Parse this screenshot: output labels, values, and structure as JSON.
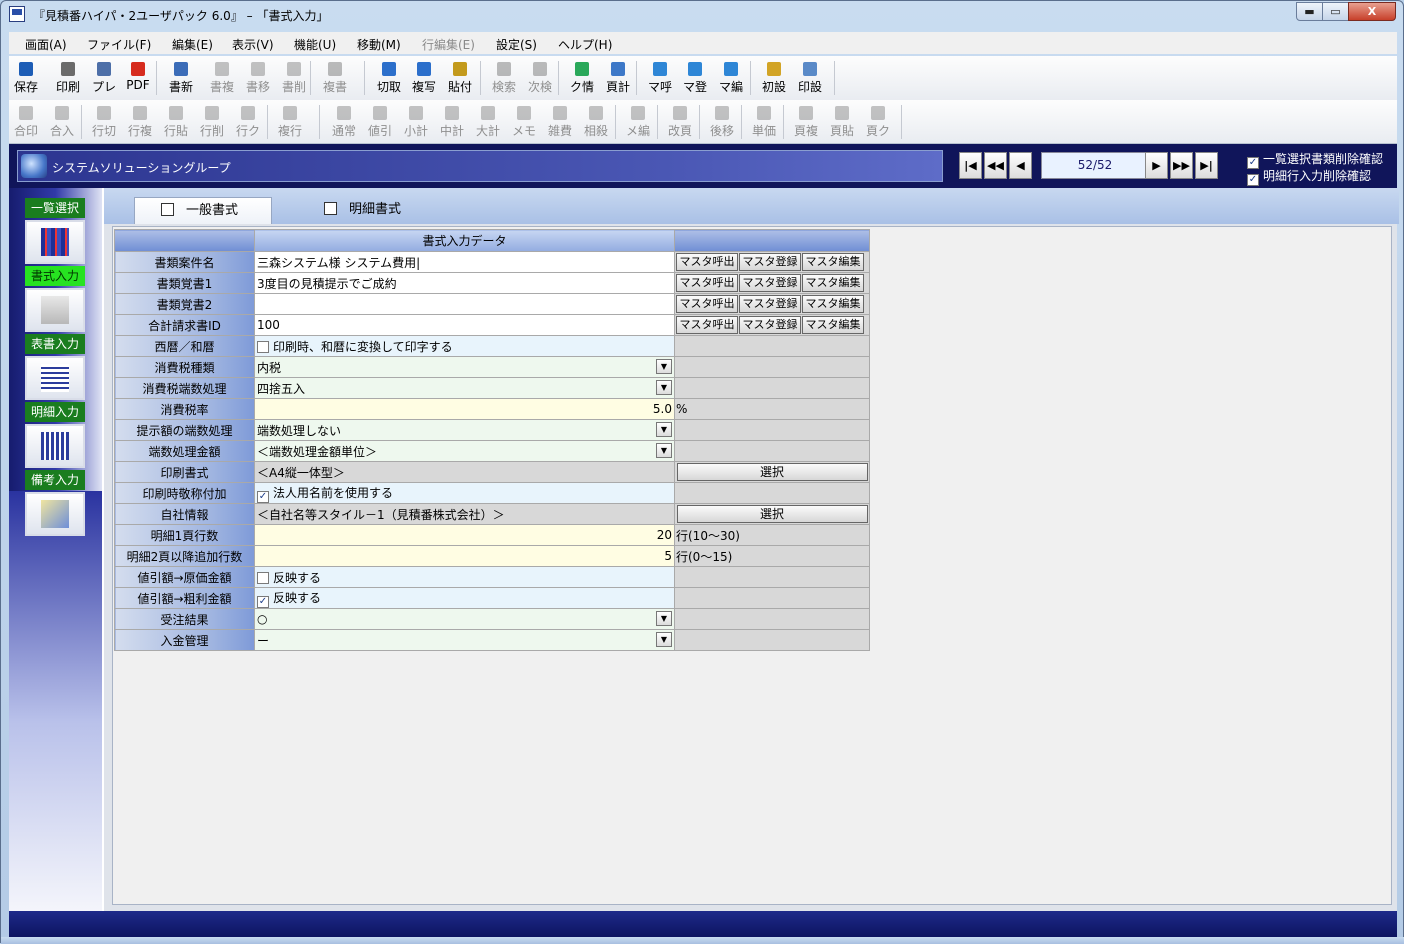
{
  "window": {
    "title": "『見積番ハイパ・2ユーザパック 6.0』 – 「書式入力」",
    "min_label": "▬",
    "max_label": "▭",
    "close_label": "X"
  },
  "menu": [
    {
      "label": "画面(A)",
      "enabled": true
    },
    {
      "label": "ファイル(F)",
      "enabled": true
    },
    {
      "label": "編集(E)",
      "enabled": true
    },
    {
      "label": "表示(V)",
      "enabled": true
    },
    {
      "label": "機能(U)",
      "enabled": true
    },
    {
      "label": "移動(M)",
      "enabled": true
    },
    {
      "label": "行編集(E)",
      "enabled": false
    },
    {
      "label": "設定(S)",
      "enabled": true
    },
    {
      "label": "ヘルプ(H)",
      "enabled": true
    }
  ],
  "toolbar1": [
    {
      "label": "保存",
      "icon": "save-icon",
      "enabled": true
    },
    {
      "label": "印刷",
      "icon": "print-icon",
      "enabled": true
    },
    {
      "label": "プレ",
      "icon": "preview-icon",
      "enabled": true
    },
    {
      "label": "PDF",
      "icon": "pdf-icon",
      "enabled": true
    },
    {
      "label": "書新",
      "icon": "new-doc-icon",
      "enabled": true
    },
    {
      "label": "書複",
      "icon": "copy-doc-icon",
      "enabled": false
    },
    {
      "label": "書移",
      "icon": "move-doc-icon",
      "enabled": false
    },
    {
      "label": "書削",
      "icon": "delete-doc-icon",
      "enabled": false
    },
    {
      "label": "複書",
      "icon": "multi-doc-icon",
      "enabled": false
    },
    {
      "label": "切取",
      "icon": "cut-icon",
      "enabled": true
    },
    {
      "label": "複写",
      "icon": "copy-icon",
      "enabled": true
    },
    {
      "label": "貼付",
      "icon": "paste-icon",
      "enabled": true
    },
    {
      "label": "検索",
      "icon": "search-icon",
      "enabled": false
    },
    {
      "label": "次検",
      "icon": "search-next-icon",
      "enabled": false
    },
    {
      "label": "ク情",
      "icon": "client-info-icon",
      "enabled": true
    },
    {
      "label": "頁計",
      "icon": "page-total-icon",
      "enabled": true
    },
    {
      "label": "マ呼",
      "icon": "master-call-icon",
      "enabled": true
    },
    {
      "label": "マ登",
      "icon": "master-register-icon",
      "enabled": true
    },
    {
      "label": "マ編",
      "icon": "master-edit-icon",
      "enabled": true
    },
    {
      "label": "初設",
      "icon": "initial-settings-icon",
      "enabled": true
    },
    {
      "label": "印設",
      "icon": "print-settings-icon",
      "enabled": true
    }
  ],
  "toolbar2": [
    {
      "label": "合印",
      "icon": "merge-print-icon"
    },
    {
      "label": "合入",
      "icon": "merge-input-icon"
    },
    {
      "label": "行切",
      "icon": "row-cut-icon"
    },
    {
      "label": "行複",
      "icon": "row-copy-icon"
    },
    {
      "label": "行貼",
      "icon": "row-paste-icon"
    },
    {
      "label": "行削",
      "icon": "row-delete-icon"
    },
    {
      "label": "行ク",
      "icon": "row-clear-icon"
    },
    {
      "label": "複行",
      "icon": "multi-row-icon"
    },
    {
      "label": "通常",
      "icon": "normal-row-icon"
    },
    {
      "label": "値引",
      "icon": "discount-icon"
    },
    {
      "label": "小計",
      "icon": "subtotal-icon"
    },
    {
      "label": "中計",
      "icon": "midtotal-icon"
    },
    {
      "label": "大計",
      "icon": "grandtotal-icon"
    },
    {
      "label": "メモ",
      "icon": "memo-icon"
    },
    {
      "label": "雑費",
      "icon": "misc-cost-icon"
    },
    {
      "label": "相殺",
      "icon": "offset-icon"
    },
    {
      "label": "メ編",
      "icon": "memo-edit-icon"
    },
    {
      "label": "改頁",
      "icon": "page-break-icon"
    },
    {
      "label": "後移",
      "icon": "move-back-icon"
    },
    {
      "label": "単価",
      "icon": "unit-price-icon"
    },
    {
      "label": "頁複",
      "icon": "page-copy-icon"
    },
    {
      "label": "頁貼",
      "icon": "page-paste-icon"
    },
    {
      "label": "頁ク",
      "icon": "page-clear-icon"
    }
  ],
  "header": {
    "group_name": "システムソリューショングループ",
    "page_indicator": "52/52",
    "nav_first": "|◀",
    "nav_prev_fast": "◀◀",
    "nav_prev": "◀",
    "nav_next": "▶",
    "nav_next_fast": "▶▶",
    "nav_last": "▶|",
    "check1_label": "一覧選択書類削除確認",
    "check2_label": "明細行入力削除確認"
  },
  "sidebar": [
    {
      "label": "一覧選択",
      "active": false,
      "icon": "list-grid-icon"
    },
    {
      "label": "書式入力",
      "active": true,
      "icon": "format-ruler-icon"
    },
    {
      "label": "表書入力",
      "active": false,
      "icon": "cover-doc-icon"
    },
    {
      "label": "明細入力",
      "active": false,
      "icon": "detail-table-icon"
    },
    {
      "label": "備考入力",
      "active": false,
      "icon": "notes-edit-icon"
    }
  ],
  "tabs": [
    {
      "label": "一般書式",
      "active": true
    },
    {
      "label": "明細書式",
      "active": false
    }
  ],
  "form": {
    "column_header": "書式入力データ",
    "master_call": "マスタ呼出",
    "master_register": "マスタ登録",
    "master_edit": "マスタ編集",
    "select": "選択",
    "rows": [
      {
        "label": "書類案件名",
        "type": "text",
        "value": "三森システム様 システム費用|",
        "actions": "master"
      },
      {
        "label": "書類覚書1",
        "type": "text",
        "value": "3度目の見積提示でご成約",
        "actions": "master"
      },
      {
        "label": "書類覚書2",
        "type": "text",
        "value": "",
        "actions": "master"
      },
      {
        "label": "合計請求書ID",
        "type": "text",
        "value": "100",
        "actions": "master"
      },
      {
        "label": "西暦／和暦",
        "type": "check",
        "checked": false,
        "value": "印刷時、和暦に変換して印字する"
      },
      {
        "label": "消費税種類",
        "type": "select",
        "value": "内税"
      },
      {
        "label": "消費税端数処理",
        "type": "select",
        "value": "四捨五入"
      },
      {
        "label": "消費税率",
        "type": "number",
        "value": "5.0",
        "suffix": "%"
      },
      {
        "label": "提示額の端数処理",
        "type": "select",
        "value": "端数処理しない"
      },
      {
        "label": "端数処理金額",
        "type": "select",
        "value": "＜端数処理金額単位＞"
      },
      {
        "label": "印刷書式",
        "type": "readonly",
        "value": "＜A4縦一体型＞",
        "actions": "select"
      },
      {
        "label": "印刷時敬称付加",
        "type": "check",
        "checked": true,
        "value": "法人用名前を使用する"
      },
      {
        "label": "自社情報",
        "type": "readonly",
        "value": "＜自社名等スタイル－1（見積番株式会社）＞",
        "actions": "select"
      },
      {
        "label": "明細1頁行数",
        "type": "number",
        "value": "20",
        "suffix": "行(10～30)"
      },
      {
        "label": "明細2頁以降追加行数",
        "type": "number",
        "value": "5",
        "suffix": "行(0～15)"
      },
      {
        "label": "値引額→原価金額",
        "type": "check",
        "checked": false,
        "value": "反映する"
      },
      {
        "label": "値引額→粗利金額",
        "type": "check",
        "checked": true,
        "value": "反映する"
      },
      {
        "label": "受注結果",
        "type": "select",
        "value": "○"
      },
      {
        "label": "入金管理",
        "type": "select",
        "value": "ー"
      }
    ]
  },
  "colors": {
    "accent_green": "#27e221",
    "nav_dark": "#10155a"
  }
}
